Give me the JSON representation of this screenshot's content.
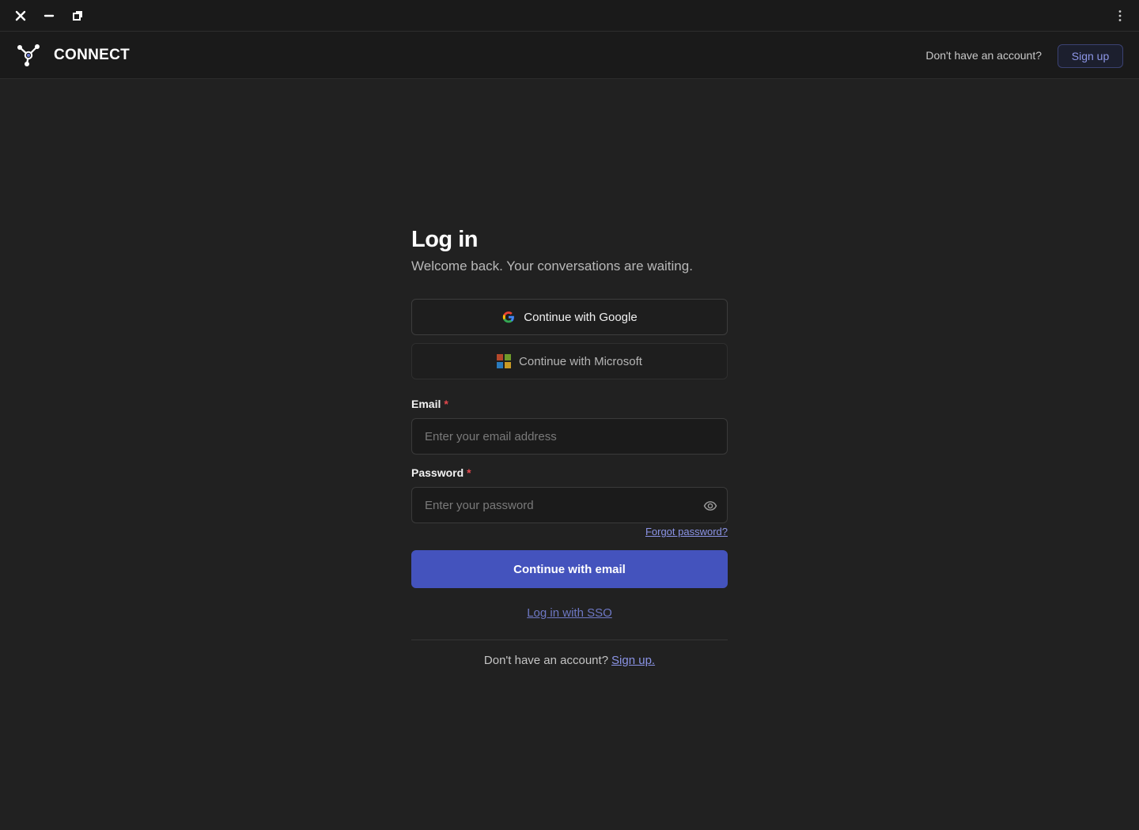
{
  "window": {
    "close_icon": "close-icon",
    "minimize_icon": "minimize-icon",
    "restore_icon": "restore-icon",
    "more_icon": "more-vertical-icon"
  },
  "header": {
    "brand": "CONNECT",
    "logo_icon": "network-nodes-icon",
    "question": "Don't have an account?",
    "signup_label": "Sign up"
  },
  "login": {
    "title": "Log in",
    "subtitle": "Welcome back. Your conversations are waiting.",
    "google_label": "Continue with Google",
    "microsoft_label": "Continue with Microsoft",
    "email": {
      "label": "Email",
      "required_mark": "*",
      "value": "",
      "placeholder": "Enter your email address"
    },
    "password": {
      "label": "Password",
      "required_mark": "*",
      "value": "",
      "placeholder": "Enter your password",
      "toggle_icon": "eye-icon"
    },
    "forgot_label": "Forgot password?",
    "submit_label": "Continue with email",
    "sso_label": "Log in with SSO",
    "footer_question": "Don't have an account?",
    "footer_link": "Sign up."
  },
  "colors": {
    "background": "#212121",
    "header_bg": "#1a1a1a",
    "accent": "#4453bd",
    "link": "#8b94e6",
    "required": "#e5484d"
  }
}
